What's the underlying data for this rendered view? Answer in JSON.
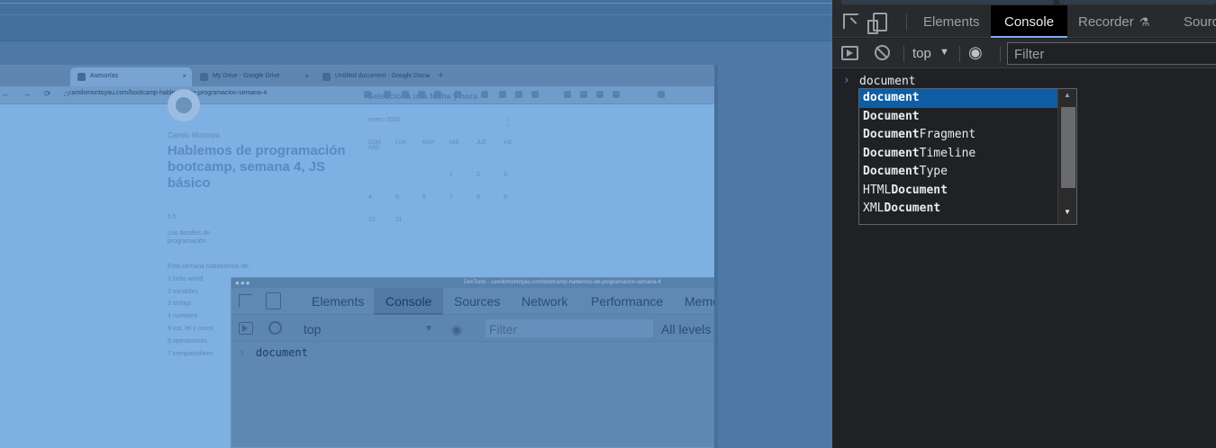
{
  "browser": {
    "tabs": [
      {
        "label": "Asesorías",
        "close": "×"
      },
      {
        "label": "My Drive - Google Drive",
        "close": "×"
      },
      {
        "label": "Untitled document - Google Docs",
        "close": "×"
      }
    ],
    "new_tab": "+",
    "nav_icons": "← → ⟳ ⌂",
    "url": "camilomontoyau.com/bootcamp-hablemos-de-programacion-semana-4"
  },
  "page": {
    "author": "Camilo Montoya",
    "title": "Hablemos de programación bootcamp, semana 4, JS básico",
    "meta_duration": "1 h",
    "meta_text": "Los detalles de programación",
    "list_intro": "Esta semana hablaremos de:",
    "list_items": [
      "1    hello world",
      "2    variables",
      "3    strings",
      "4    numbers",
      "5    var, let y const",
      "6    operaciones",
      "7    comparadores"
    ],
    "calendar": {
      "title": "Selecciona una fecha y hora",
      "month": "enero 2020",
      "nav": "‹ ›",
      "days": [
        "DOM",
        "LUN",
        "MAR",
        "MIÉ",
        "JUE",
        "VIE",
        "SÁB"
      ],
      "numbers": [
        "",
        "",
        "",
        "1",
        "2",
        "3",
        "4",
        "5",
        "6",
        "7",
        "8",
        "9",
        "10",
        "11"
      ]
    }
  },
  "inner_devtools": {
    "window_title": "DevTools - camilomontoyau.com/bootcamp-hablemos-de-programacion-semana-4",
    "window_dots": "●●●",
    "tabs": [
      "Elements",
      "Console",
      "Sources",
      "Network",
      "Performance",
      "Memo"
    ],
    "context": "top",
    "context_arrow": "▼",
    "eye": "◉",
    "filter_placeholder": "Filter",
    "levels": "All levels ▼",
    "prompt": "›",
    "command": "document"
  },
  "devtools": {
    "tabs": [
      "Elements",
      "Console",
      "Recorder",
      "Sourc"
    ],
    "recorder_icon": "⚗",
    "context": "top",
    "context_arrow": "▼",
    "eye": "◉",
    "filter_placeholder": "Filter",
    "prompt": "›",
    "command": "document",
    "autocomplete": [
      {
        "pre": "",
        "match": "document",
        "post": ""
      },
      {
        "pre": "",
        "match": "Document",
        "post": ""
      },
      {
        "pre": "",
        "match": "Document",
        "post": "Fragment"
      },
      {
        "pre": "",
        "match": "Document",
        "post": "Timeline"
      },
      {
        "pre": "",
        "match": "Document",
        "post": "Type"
      },
      {
        "pre": "HTML",
        "match": "Document",
        "post": ""
      },
      {
        "pre": "XML",
        "match": "Document",
        "post": ""
      }
    ],
    "scroll_up": "▲",
    "scroll_down": "▼"
  },
  "colors": {
    "accent": "#0f5da3",
    "prompt": "#4c8df6",
    "active_tab_underline": "#7cacf8",
    "background": "#202124"
  }
}
